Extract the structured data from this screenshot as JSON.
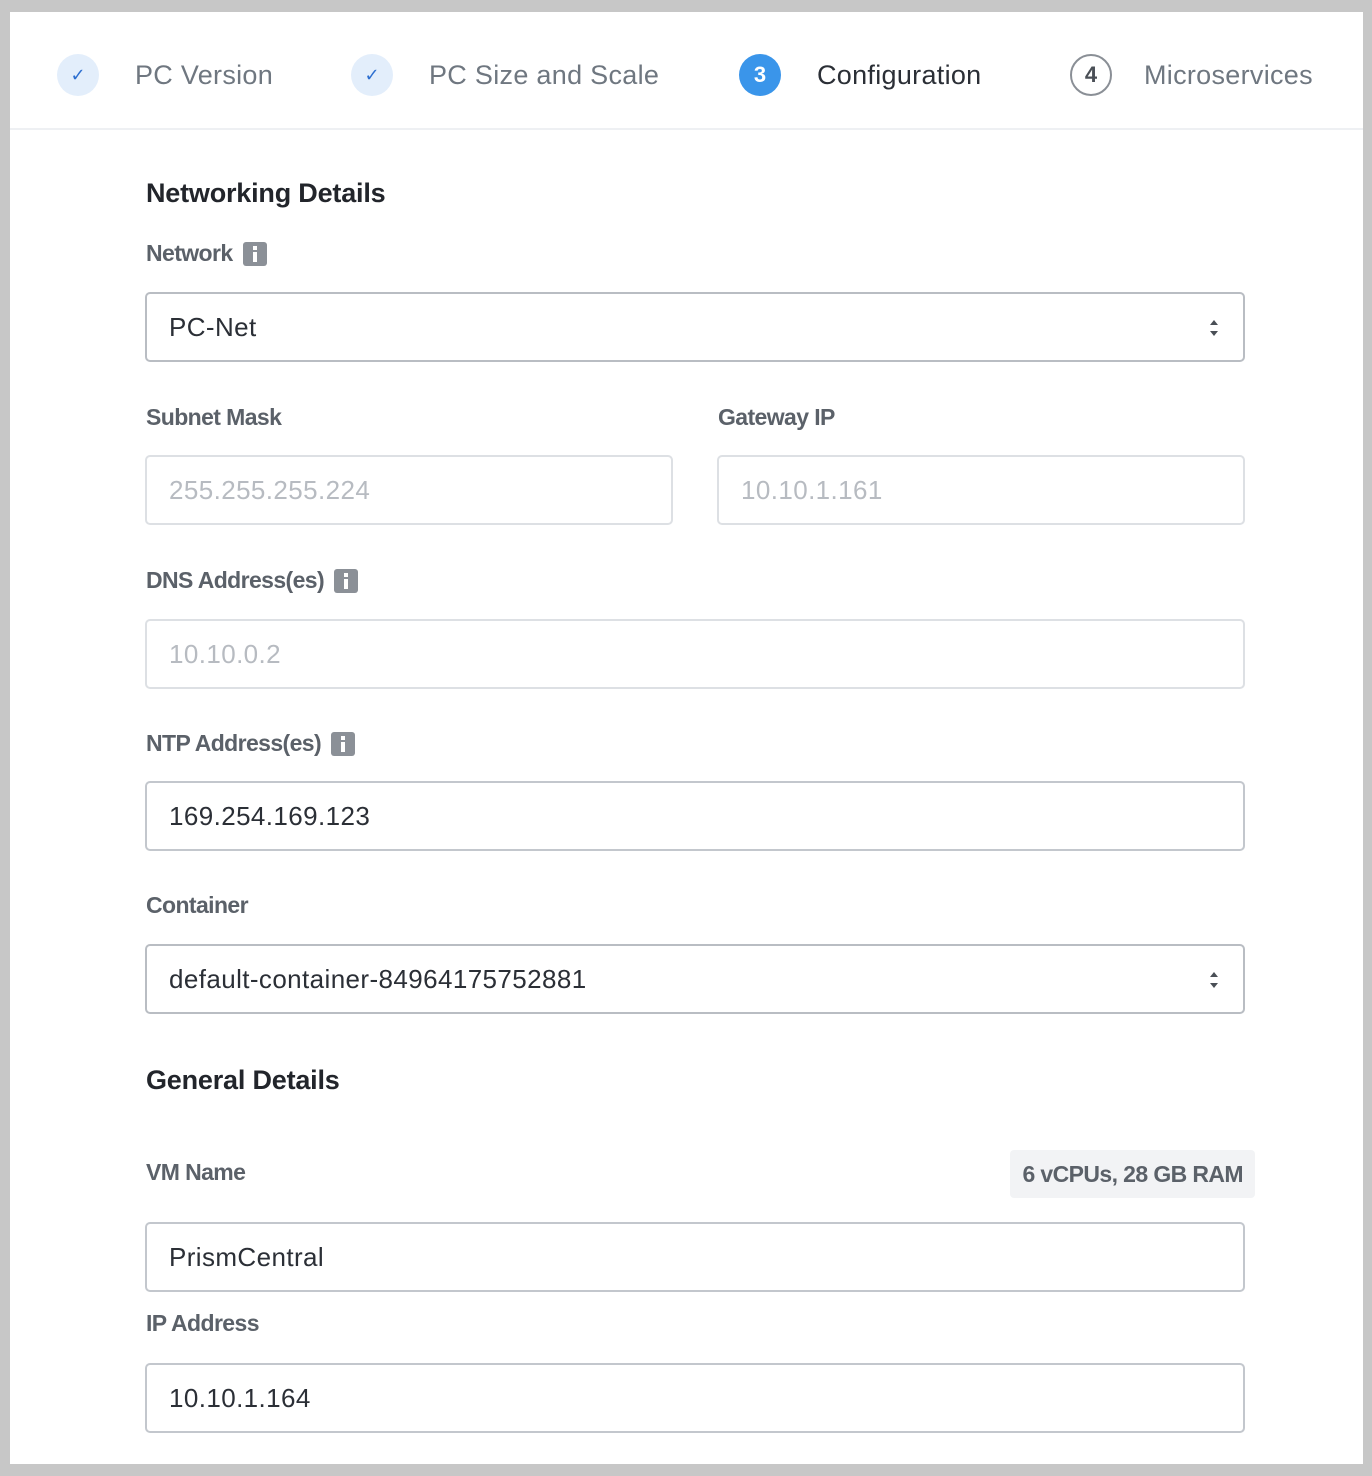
{
  "wizard": {
    "steps": [
      {
        "marker": "✓",
        "label": "PC Version",
        "state": "done"
      },
      {
        "marker": "✓",
        "label": "PC Size and Scale",
        "state": "done"
      },
      {
        "marker": "3",
        "label": "Configuration",
        "state": "active"
      },
      {
        "marker": "4",
        "label": "Microservices",
        "state": "todo"
      }
    ]
  },
  "networking": {
    "title": "Networking Details",
    "network": {
      "label": "Network",
      "value": "PC-Net"
    },
    "subnet_mask": {
      "label": "Subnet Mask",
      "value": "255.255.255.224"
    },
    "gateway_ip": {
      "label": "Gateway IP",
      "value": "10.10.1.161"
    },
    "dns": {
      "label": "DNS Address(es)",
      "value": "10.10.0.2"
    },
    "ntp": {
      "label": "NTP Address(es)",
      "value": "169.254.169.123"
    },
    "container": {
      "label": "Container",
      "value": "default-container-84964175752881"
    }
  },
  "general": {
    "title": "General Details",
    "vm_name": {
      "label": "VM Name",
      "value": "PrismCentral",
      "resources": "6 vCPUs, 28 GB RAM"
    },
    "ip_address": {
      "label": "IP Address",
      "value": "10.10.1.164"
    }
  },
  "icons": {
    "info": "info-icon",
    "check": "check-icon",
    "select": "select-arrows-icon"
  },
  "colors": {
    "accent": "#3a95ea",
    "done_bg": "#e3eefb"
  }
}
